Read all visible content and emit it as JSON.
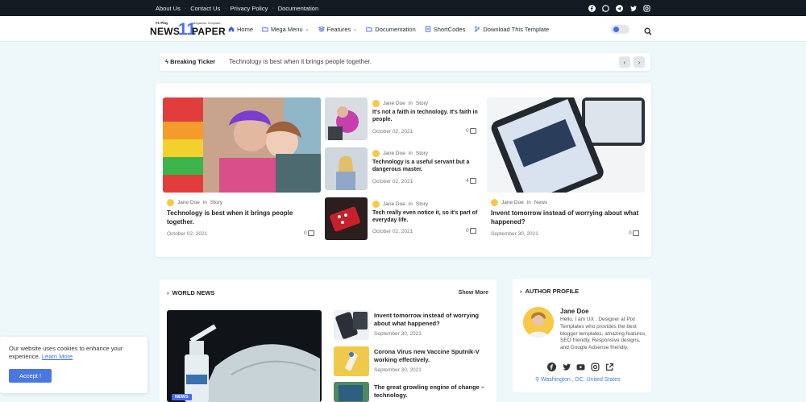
{
  "topbar": {
    "links": [
      "About Us",
      "Contact Us",
      "Privacy Policy",
      "Documentation"
    ],
    "social_icons": [
      "facebook-icon",
      "whatsapp-icon",
      "telegram-icon",
      "twitter-icon",
      "instagram-icon"
    ]
  },
  "logo": {
    "tagline": "#1 Play",
    "word1": "NEWS",
    "number": "11",
    "word2": "PAPER",
    "subtitle": "Magazine Template"
  },
  "menu": [
    {
      "label": "Home",
      "icon": "home-icon"
    },
    {
      "label": "Mega Menu",
      "icon": "folder-icon",
      "dropdown": true
    },
    {
      "label": "Features",
      "icon": "layers-icon",
      "dropdown": true
    },
    {
      "label": "Documentation",
      "icon": "folder-icon"
    },
    {
      "label": "ShortCodes",
      "icon": "code-icon"
    },
    {
      "label": "Download This Template",
      "icon": "branch-icon"
    }
  ],
  "ticker": {
    "label": "Breaking Ticker",
    "text": "Technology is best when it brings people together.",
    "prev": "‹",
    "next": "›"
  },
  "featured": {
    "main": {
      "author": "Jane Doe",
      "in": "in",
      "category": "Story",
      "title": "Technology is best when it brings people together.",
      "date": "October 02, 2021",
      "comments": "0"
    },
    "small": [
      {
        "author": "Jane Doe",
        "in": "in",
        "category": "Story",
        "title": "It's not a faith in technology. It's faith in people.",
        "date": "October 02, 2021",
        "comments": "0"
      },
      {
        "author": "Jane Doe",
        "in": "in",
        "category": "Story",
        "title": "Technology is a useful servant but a dangerous master.",
        "date": "October 02, 2021",
        "comments": "4"
      },
      {
        "author": "Jane Doe",
        "in": "in",
        "category": "Story",
        "title": "Tech really even notice it, so it's part of everyday life.",
        "date": "October 02, 2021",
        "comments": "0"
      }
    ],
    "right": {
      "author": "Jane Doe",
      "in": "in",
      "category": "News",
      "title": "Invent tomorrow instead of worrying about what happened?",
      "date": "September 30, 2021",
      "comments": "0"
    }
  },
  "world_news": {
    "heading": "WORLD NEWS",
    "show_more": "Show More",
    "badge": "NEWS",
    "items": [
      {
        "title": "Invent tomorrow instead of worrying about what happened?",
        "date": "September 30, 2021"
      },
      {
        "title": "Corona Virus new Vaccine Sputnik-V working effectively.",
        "date": "September 30, 2021"
      },
      {
        "title": "The great growling engine of change – technology.",
        "date": ""
      }
    ]
  },
  "author_profile": {
    "heading": "AUTHOR PROFILE",
    "name": "Jane Doe",
    "bio": "Hello, I am UX . Designer at Pixl Templates who provides the best blogger templates, amazing features, SEO friendly, Responsive designs, and Google Adsense friendly.",
    "location": "Washington , DC, United States",
    "social_icons": [
      "facebook-icon",
      "twitter-icon",
      "youtube-icon",
      "instagram-icon",
      "external-link-icon"
    ]
  },
  "cookie": {
    "message": "Our website uses cookies to enhance your experience.",
    "learn_more": "Learn More",
    "accept": "Accept !"
  },
  "colors": {
    "accent": "#4a6af0",
    "topbar": "#141b22",
    "background": "#eef8fb"
  }
}
